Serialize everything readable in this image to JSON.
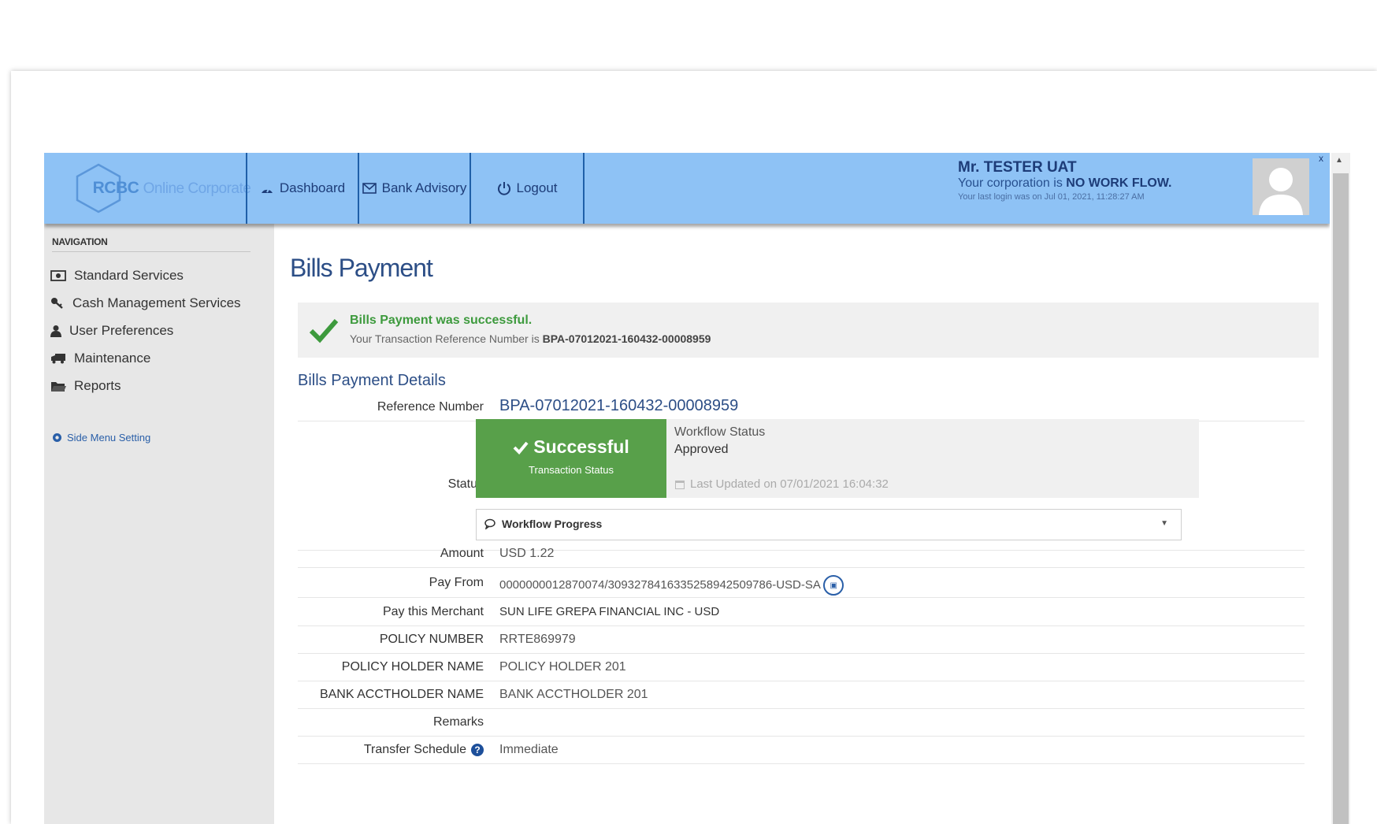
{
  "header": {
    "logo_main": "RCBC",
    "logo_sub": "Online Corporate",
    "nav": [
      {
        "label": "Dashboard",
        "icon": "dashboard-icon"
      },
      {
        "label": "Bank Advisory",
        "icon": "envelope-icon"
      },
      {
        "label": "Logout",
        "icon": "power-icon"
      }
    ],
    "user_name": "Mr. TESTER UAT",
    "corp_prefix": "Your corporation is",
    "corp_value": "NO WORK FLOW.",
    "last_login": "Your last login was on Jul 01, 2021, 11:28:27 AM",
    "close": "x"
  },
  "sidebar": {
    "heading": "NAVIGATION",
    "items": [
      {
        "label": "Standard Services",
        "icon": "money-icon"
      },
      {
        "label": "Cash Management Services",
        "icon": "key-icon"
      },
      {
        "label": "User Preferences",
        "icon": "user-icon"
      },
      {
        "label": "Maintenance",
        "icon": "truck-icon"
      },
      {
        "label": "Reports",
        "icon": "folder-icon"
      }
    ],
    "setting": "Side Menu Setting"
  },
  "main": {
    "title": "Bills Payment",
    "success_title": "Bills Payment was successful.",
    "success_ref_prefix": "Your Transaction Reference Number is",
    "success_ref": "BPA-07012021-160432-00008959",
    "section_title": "Bills Payment Details",
    "reference_label": "Reference Number",
    "reference_value": "BPA-07012021-160432-00008959",
    "status_label": "Status",
    "status_main": "Successful",
    "status_sub": "Transaction Status",
    "workflow_status_label": "Workflow Status",
    "workflow_status_value": "Approved",
    "last_updated": "Last Updated on 07/01/2021 16:04:32",
    "workflow_progress": "Workflow Progress",
    "details": [
      {
        "label": "Amount",
        "value": "USD 1.22"
      },
      {
        "label": "Pay From",
        "value": "0000000012870074/309327841633525894250978​6-USD-SA"
      },
      {
        "label": "Pay this Merchant",
        "value": "SUN LIFE GREPA FINANCIAL INC - USD"
      },
      {
        "label": "POLICY NUMBER",
        "value": "RRTE869979"
      },
      {
        "label": "POLICY HOLDER NAME",
        "value": "POLICY HOLDER 201"
      },
      {
        "label": "BANK ACCTHOLDER NAME",
        "value": "BANK ACCTHOLDER 201"
      },
      {
        "label": "Remarks",
        "value": ""
      },
      {
        "label": "Transfer Schedule",
        "value": "Immediate"
      }
    ]
  },
  "colors": {
    "header_bg": "#8ec2f5",
    "sidebar_bg": "#e7e7e7",
    "success_green": "#58a04a",
    "title_blue": "#2c4e86"
  }
}
